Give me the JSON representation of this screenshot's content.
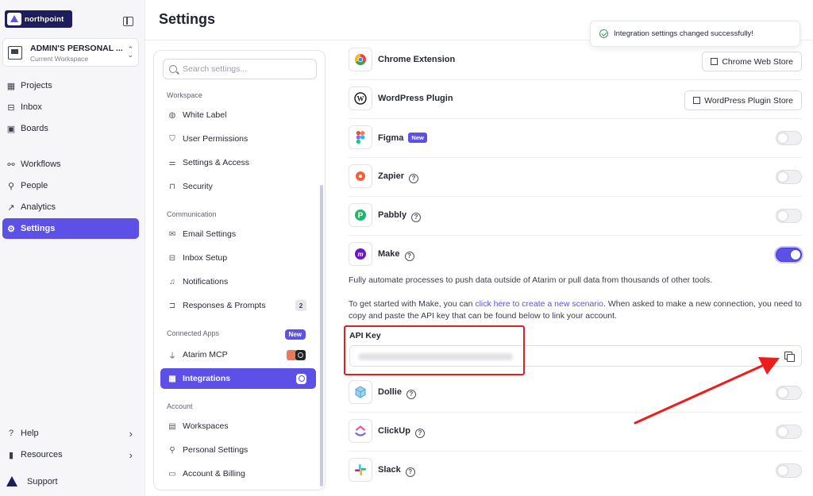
{
  "brand": {
    "name": "northpoint"
  },
  "workspace": {
    "name": "ADMIN'S PERSONAL ...",
    "subtitle": "Current Workspace"
  },
  "nav": {
    "projects": "Projects",
    "inbox": "Inbox",
    "boards": "Boards",
    "workflows": "Workflows",
    "people": "People",
    "analytics": "Analytics",
    "settings": "Settings",
    "help": "Help",
    "resources": "Resources",
    "support": "Support"
  },
  "page": {
    "title": "Settings"
  },
  "toast": {
    "message": "Integration settings changed successfully!"
  },
  "settings_panel": {
    "search_placeholder": "Search settings...",
    "sections": {
      "workspace": "Workspace",
      "communication": "Communication",
      "connected_apps": "Connected Apps",
      "account": "Account"
    },
    "connected_apps_badge": "New",
    "items": {
      "white_label": "White Label",
      "user_permissions": "User Permissions",
      "settings_access": "Settings & Access",
      "security": "Security",
      "email_settings": "Email Settings",
      "inbox_setup": "Inbox Setup",
      "notifications": "Notifications",
      "responses_prompts": "Responses & Prompts",
      "responses_count": "2",
      "atarim_mcp": "Atarim MCP",
      "integrations": "Integrations",
      "workspaces": "Workspaces",
      "personal_settings": "Personal Settings",
      "account_billing": "Account & Billing"
    }
  },
  "integrations": {
    "chrome": {
      "name": "Chrome Extension",
      "button": "Chrome Web Store"
    },
    "wordpress": {
      "name": "WordPress Plugin",
      "button": "WordPress Plugin Store"
    },
    "figma": {
      "name": "Figma",
      "badge": "New",
      "enabled": false
    },
    "zapier": {
      "name": "Zapier",
      "enabled": false
    },
    "pabbly": {
      "name": "Pabbly",
      "enabled": false
    },
    "make": {
      "name": "Make",
      "enabled": true,
      "description": "Fully automate processes to push data outside of Atarim or pull data from thousands of other tools.",
      "start_prefix": "To get started with Make, you can ",
      "start_link": "click here to create a new scenario",
      "start_suffix": ". When asked to make a new connection, you need to copy and paste the API key that can be found below to link your account.",
      "api_label": "API Key"
    },
    "dollie": {
      "name": "Dollie",
      "enabled": false
    },
    "clickup": {
      "name": "ClickUp",
      "enabled": false
    },
    "slack": {
      "name": "Slack",
      "enabled": false
    }
  },
  "colors": {
    "accent": "#5d50e6",
    "annotation_red": "#e02020",
    "success": "#2e9c5e"
  }
}
